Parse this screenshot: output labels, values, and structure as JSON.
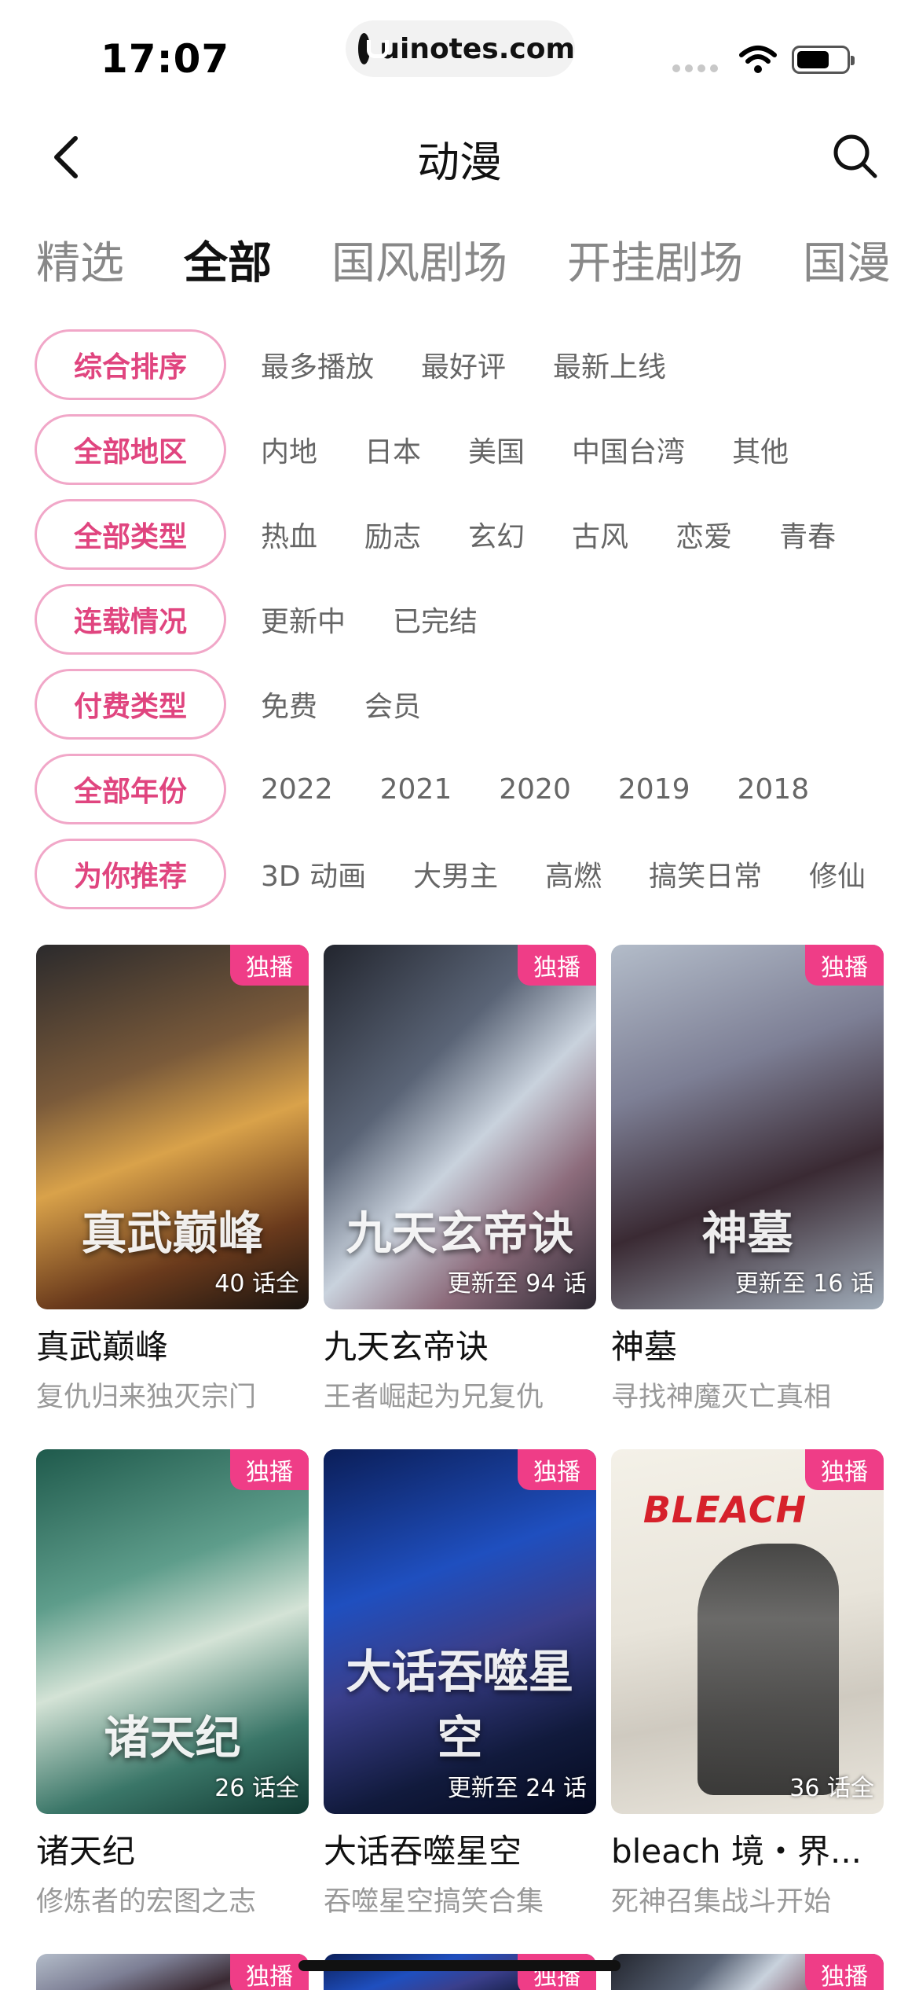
{
  "status_bar": {
    "time": "17:07",
    "url": "uinotes.com"
  },
  "nav": {
    "title": "动漫",
    "back_icon": "back-chevron-icon",
    "search_icon": "search-icon"
  },
  "tabs": [
    {
      "label": "精选",
      "active": false
    },
    {
      "label": "全部",
      "active": true
    },
    {
      "label": "国风剧场",
      "active": false
    },
    {
      "label": "开挂剧场",
      "active": false
    },
    {
      "label": "国漫",
      "active": false
    }
  ],
  "filters": [
    {
      "pill": "综合排序",
      "options": [
        "最多播放",
        "最好评",
        "最新上线"
      ]
    },
    {
      "pill": "全部地区",
      "options": [
        "内地",
        "日本",
        "美国",
        "中国台湾",
        "其他"
      ]
    },
    {
      "pill": "全部类型",
      "options": [
        "热血",
        "励志",
        "玄幻",
        "古风",
        "恋爱",
        "青春"
      ]
    },
    {
      "pill": "连载情况",
      "options": [
        "更新中",
        "已完结"
      ]
    },
    {
      "pill": "付费类型",
      "options": [
        "免费",
        "会员"
      ]
    },
    {
      "pill": "全部年份",
      "options": [
        "2022",
        "2021",
        "2020",
        "2019",
        "2018"
      ]
    },
    {
      "pill": "为你推荐",
      "options": [
        "3D 动画",
        "大男主",
        "高燃",
        "搞笑日常",
        "修仙"
      ]
    }
  ],
  "cards": [
    {
      "badge": "独播",
      "episodes": "40 话全",
      "title": "真武巅峰",
      "subtitle": "复仇归来独灭宗门",
      "art": "真武巅峰"
    },
    {
      "badge": "独播",
      "episodes": "更新至 94 话",
      "title": "九天玄帝诀",
      "subtitle": "王者崛起为兄复仇",
      "art": "九天玄帝诀"
    },
    {
      "badge": "独播",
      "episodes": "更新至 16 话",
      "title": "神墓",
      "subtitle": "寻找神魔灭亡真相",
      "art": "神墓"
    },
    {
      "badge": "独播",
      "episodes": "26 话全",
      "title": "诸天纪",
      "subtitle": "修炼者的宏图之志",
      "art": "诸天纪"
    },
    {
      "badge": "独播",
      "episodes": "更新至 24 话",
      "title": "大话吞噬星空",
      "subtitle": "吞噬星空搞笑合集",
      "art": "大话吞噬星空"
    },
    {
      "badge": "独播",
      "episodes": "36 话全",
      "title": "bleach 境・界...",
      "subtitle": "死神召集战斗开始",
      "art": "BLEACH"
    }
  ],
  "partial_badges": [
    "独播",
    "独播",
    "独播"
  ]
}
